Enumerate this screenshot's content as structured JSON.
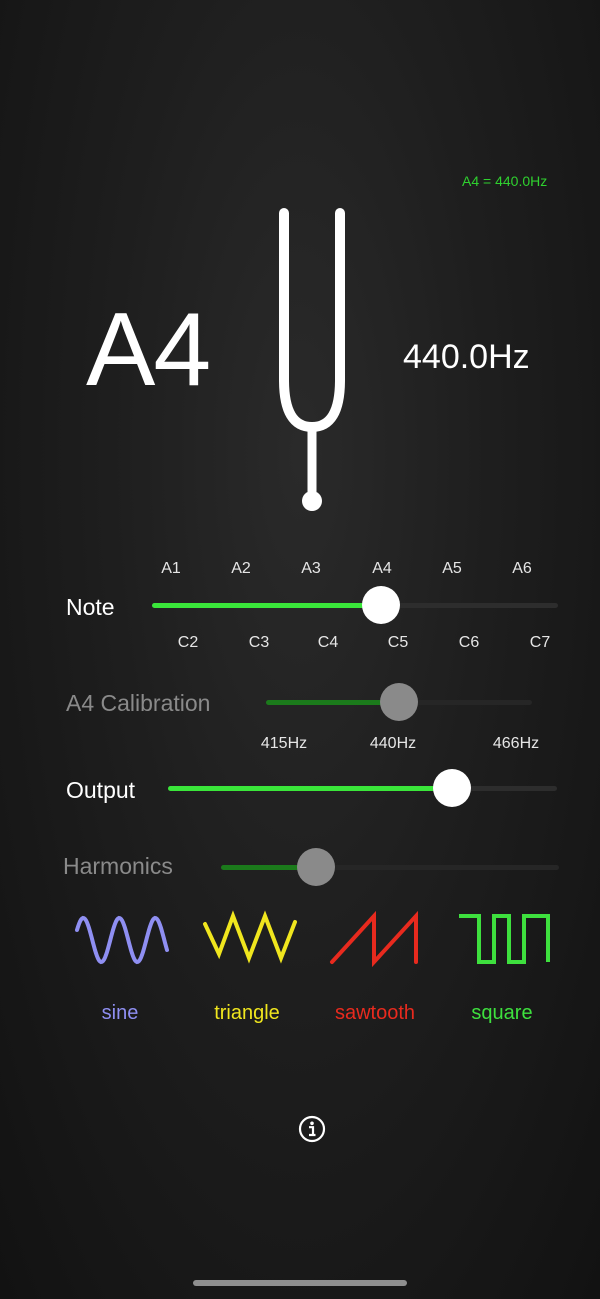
{
  "reference": "A4 = 440.0Hz",
  "current": {
    "note": "A4",
    "frequency": "440.0Hz"
  },
  "note_slider": {
    "label": "Note",
    "top_ticks": [
      "A1",
      "A2",
      "A3",
      "A4",
      "A5",
      "A6"
    ],
    "bottom_ticks": [
      "C2",
      "C3",
      "C4",
      "C5",
      "C6",
      "C7"
    ],
    "value_fraction": 0.565
  },
  "calibration_slider": {
    "label": "A4 Calibration",
    "ticks": [
      "415Hz",
      "440Hz",
      "466Hz"
    ],
    "value_fraction": 0.5
  },
  "output_slider": {
    "label": "Output",
    "value_fraction": 0.73
  },
  "harmonics_slider": {
    "label": "Harmonics",
    "value_fraction": 0.28
  },
  "waveforms": [
    {
      "label": "sine",
      "icon": "sine-wave-icon",
      "color": "#8f8ff2"
    },
    {
      "label": "triangle",
      "icon": "triangle-wave-icon",
      "color": "#f0e61e"
    },
    {
      "label": "sawtooth",
      "icon": "sawtooth-wave-icon",
      "color": "#e82a1e"
    },
    {
      "label": "square",
      "icon": "square-wave-icon",
      "color": "#3ee03e"
    }
  ],
  "colors": {
    "accent_green": "#2fd12f",
    "disabled_gray": "#8a8a8a"
  },
  "icons": {
    "fork": "tuning-fork-icon",
    "info": "info-icon"
  }
}
